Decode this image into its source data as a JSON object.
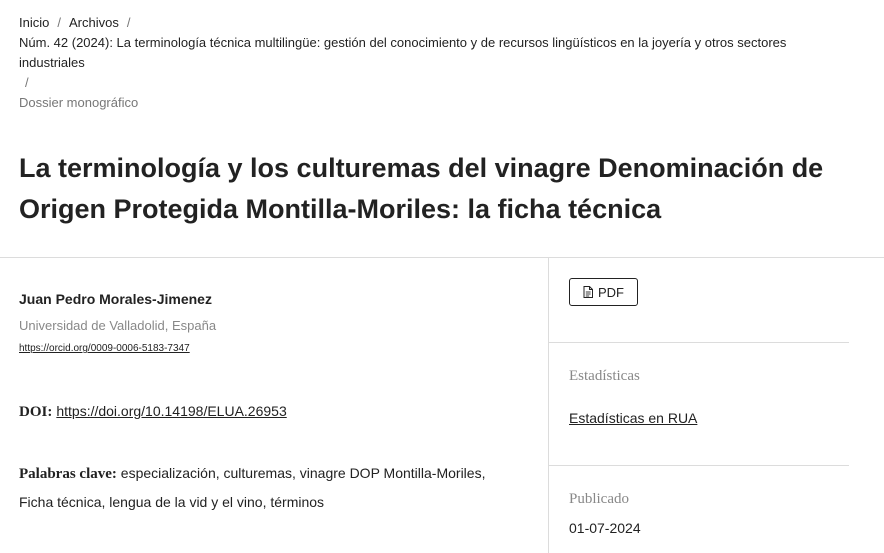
{
  "breadcrumb": {
    "home": "Inicio",
    "archive": "Archivos",
    "issue": "Núm. 42 (2024): La terminología técnica multilingüe: gestión del conocimiento y de recursos lingüísticos en la joyería y otros sectores industriales",
    "section": "Dossier monográfico",
    "separator": "/"
  },
  "article": {
    "title": "La terminología y los culturemas del vinagre Denominación de Origen Protegida Montilla-Moriles: la ficha técnica",
    "author": {
      "name": "Juan Pedro Morales-Jimenez",
      "affiliation": "Universidad de Valladolid, España",
      "orcid": "https://orcid.org/0009-0006-5183-7347"
    },
    "doi_label": "DOI:",
    "doi": "https://doi.org/10.14198/ELUA.26953",
    "keywords_label": "Palabras clave:",
    "keywords": "especialización, culturemas, vinagre DOP Montilla-Moriles, Ficha técnica, lengua de la vid y el vino, términos"
  },
  "sidebar": {
    "pdf_label": "PDF",
    "pdf_icon": "document-icon",
    "stats_heading": "Estadísticas",
    "stats_link": "Estadísticas en RUA",
    "published_heading": "Publicado",
    "published_date": "01-07-2024"
  }
}
